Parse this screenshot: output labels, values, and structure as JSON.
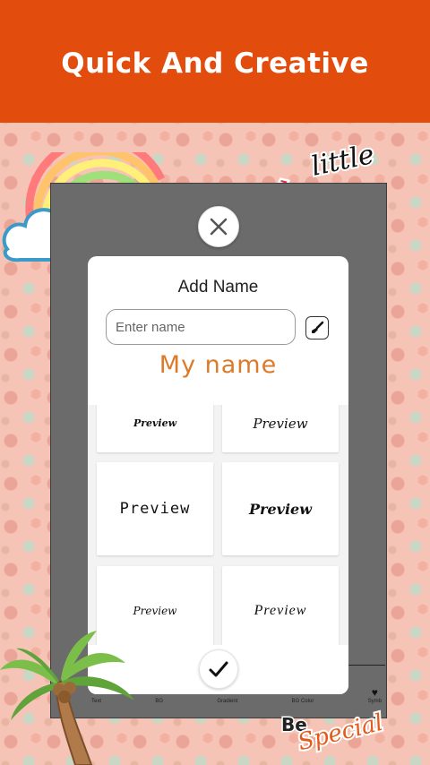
{
  "header": {
    "title": "Quick And Creative"
  },
  "dialog": {
    "title": "Add Name",
    "input": {
      "placeholder": "Enter name",
      "value": ""
    },
    "preview_text": "My name",
    "font_options": [
      {
        "label": "Preview"
      },
      {
        "label": "Preview"
      },
      {
        "label": "Preview"
      },
      {
        "label": "Preview"
      },
      {
        "label": "Preview"
      },
      {
        "label": "Preview"
      }
    ]
  },
  "toolbar": {
    "items": [
      {
        "label": "Text"
      },
      {
        "label": "BG"
      },
      {
        "label": "Gradient"
      },
      {
        "label": "BG Color"
      },
      {
        "label": "Symb"
      }
    ]
  },
  "stickers": {
    "top_line1": "little",
    "top_line2": "loves",
    "bottom_be": "Be",
    "bottom_special": "Special"
  },
  "colors": {
    "header_bg": "#e24c0d",
    "preview_text": "#dd7a2a",
    "background": "#f6c4b6"
  }
}
